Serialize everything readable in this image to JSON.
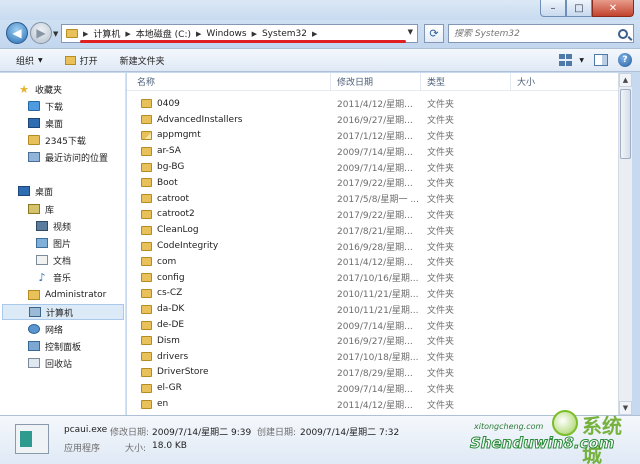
{
  "window": {
    "caption_buttons": {
      "minimize": "–",
      "maximize": "□",
      "close": "✕"
    }
  },
  "address": {
    "back_glyph": "◀",
    "forward_glyph": "▶",
    "crumbs": [
      "计算机",
      "本地磁盘 (C:)",
      "Windows",
      "System32"
    ],
    "search_placeholder": "搜索 System32",
    "underline_color": "#e02020"
  },
  "toolbar": {
    "organize": "组织",
    "open": "打开",
    "new_folder": "新建文件夹",
    "help": "?"
  },
  "nav": {
    "items": [
      {
        "label": "收藏夹",
        "icon": "star-icon"
      },
      {
        "label": "下载",
        "icon": "download-folder-icon"
      },
      {
        "label": "桌面",
        "icon": "desktop-icon"
      },
      {
        "label": "2345下载",
        "icon": "folder-icon"
      },
      {
        "label": "最近访问的位置",
        "icon": "recent-places-icon"
      },
      {
        "label": "桌面",
        "icon": "desktop-icon"
      },
      {
        "label": "库",
        "icon": "library-icon"
      },
      {
        "label": "视频",
        "icon": "video-icon"
      },
      {
        "label": "图片",
        "icon": "pictures-icon"
      },
      {
        "label": "文档",
        "icon": "documents-icon"
      },
      {
        "label": "音乐",
        "icon": "music-icon"
      },
      {
        "label": "Administrator",
        "icon": "user-folder-icon"
      },
      {
        "label": "计算机",
        "icon": "computer-icon"
      },
      {
        "label": "网络",
        "icon": "network-icon"
      },
      {
        "label": "控制面板",
        "icon": "control-panel-icon"
      },
      {
        "label": "回收站",
        "icon": "recycle-bin-icon"
      }
    ]
  },
  "columns": {
    "name": "名称",
    "date": "修改日期",
    "type": "类型",
    "size": "大小"
  },
  "files": [
    {
      "name": "0409",
      "date": "2011/4/12/星期...",
      "type": "文件夹"
    },
    {
      "name": "AdvancedInstallers",
      "date": "2016/9/27/星期...",
      "type": "文件夹"
    },
    {
      "name": "appmgmt",
      "date": "2017/1/12/星期...",
      "type": "文件夹"
    },
    {
      "name": "ar-SA",
      "date": "2009/7/14/星期...",
      "type": "文件夹"
    },
    {
      "name": "bg-BG",
      "date": "2009/7/14/星期...",
      "type": "文件夹"
    },
    {
      "name": "Boot",
      "date": "2017/9/22/星期...",
      "type": "文件夹"
    },
    {
      "name": "catroot",
      "date": "2017/5/8/星期一 ...",
      "type": "文件夹"
    },
    {
      "name": "catroot2",
      "date": "2017/9/22/星期...",
      "type": "文件夹"
    },
    {
      "name": "CleanLog",
      "date": "2017/8/21/星期...",
      "type": "文件夹"
    },
    {
      "name": "CodeIntegrity",
      "date": "2016/9/28/星期...",
      "type": "文件夹"
    },
    {
      "name": "com",
      "date": "2011/4/12/星期...",
      "type": "文件夹"
    },
    {
      "name": "config",
      "date": "2017/10/16/星期...",
      "type": "文件夹"
    },
    {
      "name": "cs-CZ",
      "date": "2010/11/21/星期...",
      "type": "文件夹"
    },
    {
      "name": "da-DK",
      "date": "2010/11/21/星期...",
      "type": "文件夹"
    },
    {
      "name": "de-DE",
      "date": "2009/7/14/星期...",
      "type": "文件夹"
    },
    {
      "name": "Dism",
      "date": "2016/9/27/星期...",
      "type": "文件夹"
    },
    {
      "name": "drivers",
      "date": "2017/10/18/星期...",
      "type": "文件夹"
    },
    {
      "name": "DriverStore",
      "date": "2017/8/29/星期...",
      "type": "文件夹"
    },
    {
      "name": "el-GR",
      "date": "2009/7/14/星期...",
      "type": "文件夹"
    },
    {
      "name": "en",
      "date": "2011/4/12/星期...",
      "type": "文件夹"
    }
  ],
  "details": {
    "file_name": "pcaui.exe",
    "file_type": "应用程序",
    "modified_label": "修改日期:",
    "modified_value": "2009/7/14/星期二 9:39",
    "size_label": "大小:",
    "size_value": "18.0 KB",
    "created_label": "创建日期:",
    "created_value": "2009/7/14/星期二 7:32"
  },
  "watermark": {
    "logo_text": "系统城",
    "brand": "Shenduwin8.com",
    "site": "xitongcheng.com"
  }
}
